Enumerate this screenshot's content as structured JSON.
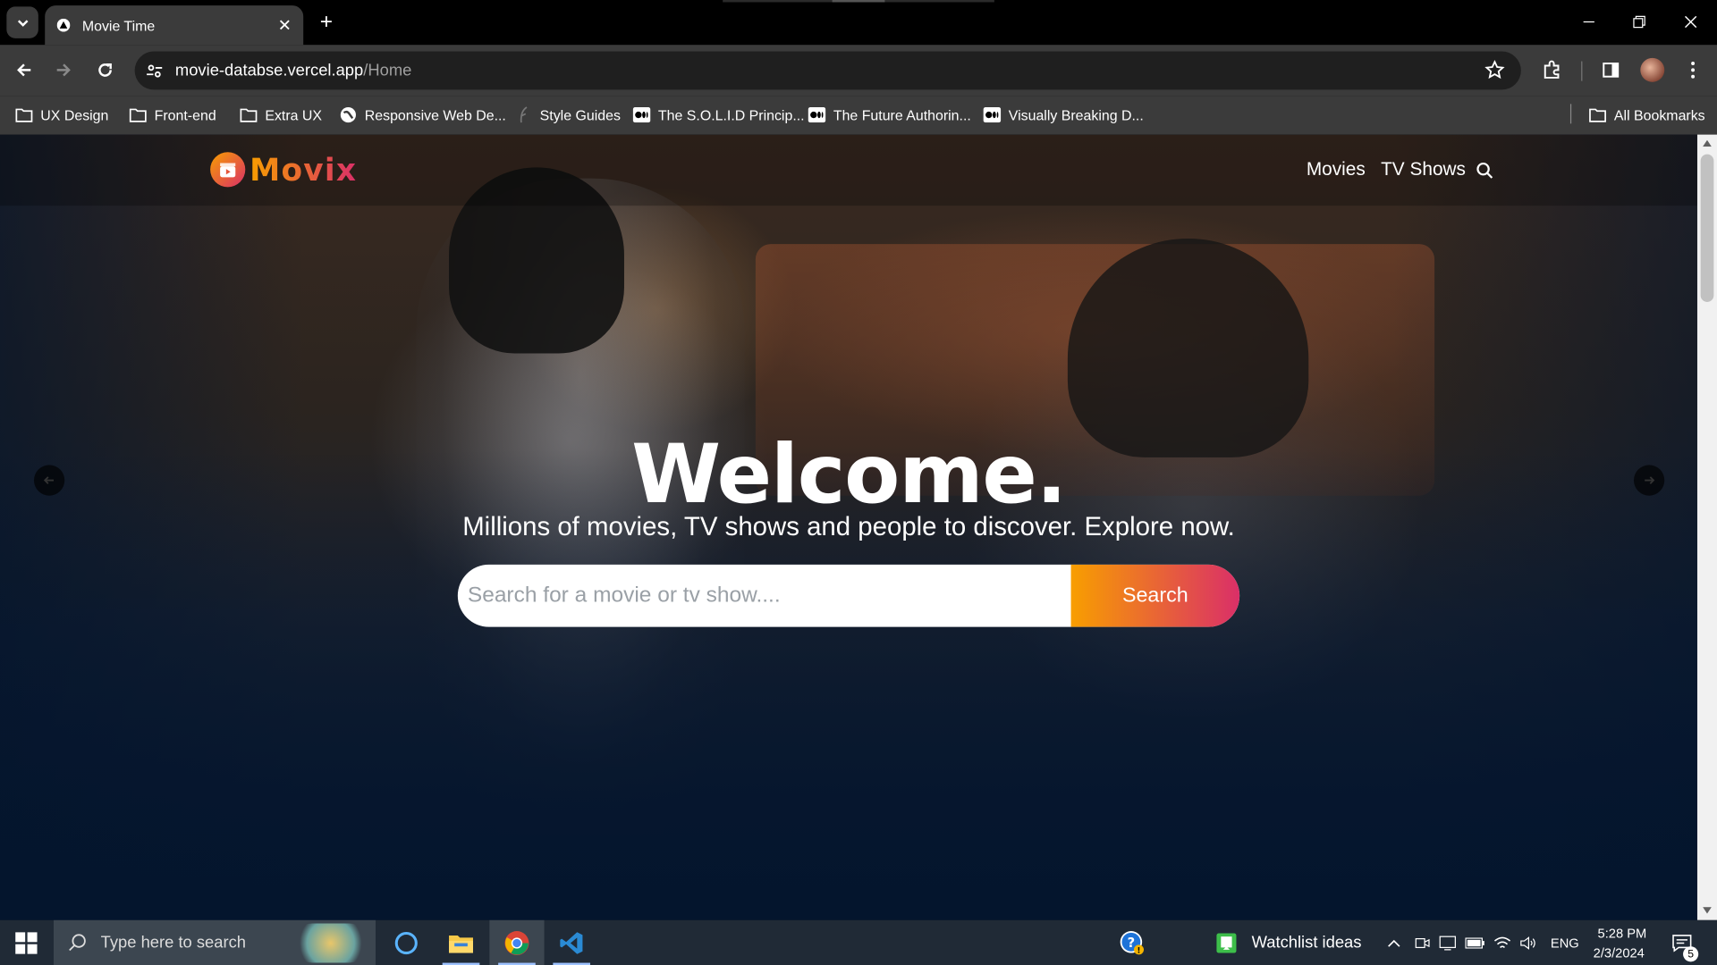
{
  "browser": {
    "tab_title": "Movie Time",
    "url_host": "movie-databse.vercel.app",
    "url_path": "/Home",
    "bookmarks": [
      {
        "label": "UX Design",
        "icon": "folder-icon"
      },
      {
        "label": "Front-end",
        "icon": "folder-icon"
      },
      {
        "label": "Extra UX",
        "icon": "folder-icon"
      },
      {
        "label": "Responsive Web De...",
        "icon": "globe-icon"
      },
      {
        "label": "Style Guides",
        "icon": "feather-icon"
      },
      {
        "label": "The S.O.L.I.D Princip...",
        "icon": "medium-icon"
      },
      {
        "label": "The Future Authorin...",
        "icon": "medium-icon"
      },
      {
        "label": "Visually Breaking D...",
        "icon": "medium-icon"
      }
    ],
    "all_bookmarks": "All Bookmarks"
  },
  "site": {
    "logo": "Movix",
    "nav": {
      "movies": "Movies",
      "tv_shows": "TV Shows"
    },
    "hero": {
      "title": "Welcome.",
      "subtitle": "Millions of movies, TV shows and people to discover. Explore now.",
      "search_placeholder": "Search for a movie or tv show....",
      "search_button": "Search"
    },
    "colors": {
      "gradient_start": "#f89e00",
      "gradient_end": "#da2f68",
      "background": "#04152d"
    }
  },
  "taskbar": {
    "search_placeholder": "Type here to search",
    "watchlist": "Watchlist ideas",
    "language": "ENG",
    "time": "5:28 PM",
    "date": "2/3/2024",
    "notification_count": "5"
  }
}
